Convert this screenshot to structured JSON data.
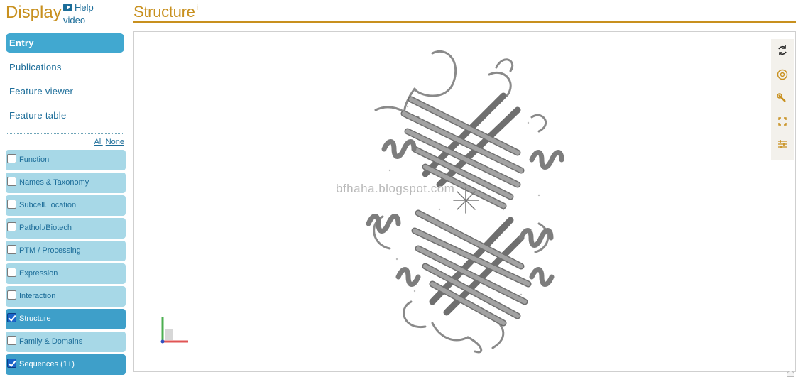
{
  "sidebar": {
    "title": "Display",
    "help_line1": "Help",
    "help_line2": "video",
    "nav": [
      {
        "label": "Entry",
        "active": true
      },
      {
        "label": "Publications",
        "active": false
      },
      {
        "label": "Feature viewer",
        "active": false
      },
      {
        "label": "Feature table",
        "active": false
      }
    ],
    "all_label": "All",
    "none_label": "None",
    "sections": [
      {
        "label": "Function",
        "checked": false
      },
      {
        "label": "Names & Taxonomy",
        "checked": false
      },
      {
        "label": "Subcell. location",
        "checked": false
      },
      {
        "label": "Pathol./Biotech",
        "checked": false
      },
      {
        "label": "PTM / Processing",
        "checked": false
      },
      {
        "label": "Expression",
        "checked": false
      },
      {
        "label": "Interaction",
        "checked": false
      },
      {
        "label": "Structure",
        "checked": true
      },
      {
        "label": "Family & Domains",
        "checked": false
      },
      {
        "label": "Sequences (1+)",
        "checked": true
      }
    ]
  },
  "main": {
    "title": "Structure",
    "info_marker": "i",
    "watermark": "bfhaha.blogspot.com",
    "tools": [
      "spin-icon",
      "camera-icon",
      "wrench-icon",
      "expand-icon",
      "sliders-icon"
    ]
  },
  "colors": {
    "accent_gold": "#c8901e",
    "link_blue": "#1c6d99",
    "active_blue": "#41a8d0",
    "section_light": "#a7d8e7",
    "section_checked": "#3e9fc9",
    "ribbon_grey": "#888888"
  }
}
